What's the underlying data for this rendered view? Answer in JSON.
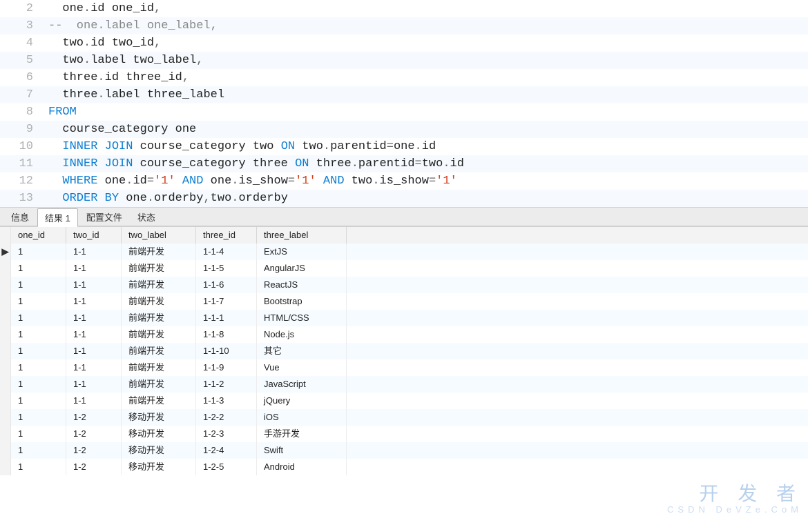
{
  "code": {
    "lines": [
      {
        "num": 2,
        "tokens": [
          {
            "t": "plain",
            "v": "  one"
          },
          {
            "t": "op",
            "v": "."
          },
          {
            "t": "plain",
            "v": "id one_id"
          },
          {
            "t": "op",
            "v": ","
          }
        ]
      },
      {
        "num": 3,
        "tokens": [
          {
            "t": "comment",
            "v": "--  one.label one_label,"
          }
        ]
      },
      {
        "num": 4,
        "tokens": [
          {
            "t": "plain",
            "v": "  two"
          },
          {
            "t": "op",
            "v": "."
          },
          {
            "t": "plain",
            "v": "id two_id"
          },
          {
            "t": "op",
            "v": ","
          }
        ]
      },
      {
        "num": 5,
        "tokens": [
          {
            "t": "plain",
            "v": "  two"
          },
          {
            "t": "op",
            "v": "."
          },
          {
            "t": "plain",
            "v": "label two_label"
          },
          {
            "t": "op",
            "v": ","
          }
        ]
      },
      {
        "num": 6,
        "tokens": [
          {
            "t": "plain",
            "v": "  three"
          },
          {
            "t": "op",
            "v": "."
          },
          {
            "t": "plain",
            "v": "id three_id"
          },
          {
            "t": "op",
            "v": ","
          }
        ]
      },
      {
        "num": 7,
        "tokens": [
          {
            "t": "plain",
            "v": "  three"
          },
          {
            "t": "op",
            "v": "."
          },
          {
            "t": "plain",
            "v": "label three_label"
          }
        ]
      },
      {
        "num": 8,
        "tokens": [
          {
            "t": "keyword",
            "v": "FROM"
          }
        ]
      },
      {
        "num": 9,
        "tokens": [
          {
            "t": "plain",
            "v": "  course_category one"
          }
        ]
      },
      {
        "num": 10,
        "tokens": [
          {
            "t": "plain",
            "v": "  "
          },
          {
            "t": "keyword",
            "v": "INNER JOIN"
          },
          {
            "t": "plain",
            "v": " course_category two "
          },
          {
            "t": "keyword",
            "v": "ON"
          },
          {
            "t": "plain",
            "v": " two"
          },
          {
            "t": "op",
            "v": "."
          },
          {
            "t": "plain",
            "v": "parentid"
          },
          {
            "t": "op",
            "v": "="
          },
          {
            "t": "plain",
            "v": "one"
          },
          {
            "t": "op",
            "v": "."
          },
          {
            "t": "plain",
            "v": "id"
          }
        ]
      },
      {
        "num": 11,
        "tokens": [
          {
            "t": "plain",
            "v": "  "
          },
          {
            "t": "keyword",
            "v": "INNER JOIN"
          },
          {
            "t": "plain",
            "v": " course_category three "
          },
          {
            "t": "keyword",
            "v": "ON"
          },
          {
            "t": "plain",
            "v": " three"
          },
          {
            "t": "op",
            "v": "."
          },
          {
            "t": "plain",
            "v": "parentid"
          },
          {
            "t": "op",
            "v": "="
          },
          {
            "t": "plain",
            "v": "two"
          },
          {
            "t": "op",
            "v": "."
          },
          {
            "t": "plain",
            "v": "id"
          }
        ]
      },
      {
        "num": 12,
        "tokens": [
          {
            "t": "plain",
            "v": "  "
          },
          {
            "t": "keyword",
            "v": "WHERE"
          },
          {
            "t": "plain",
            "v": " one"
          },
          {
            "t": "op",
            "v": "."
          },
          {
            "t": "plain",
            "v": "id"
          },
          {
            "t": "op",
            "v": "="
          },
          {
            "t": "string",
            "v": "'1'"
          },
          {
            "t": "plain",
            "v": " "
          },
          {
            "t": "keyword",
            "v": "AND"
          },
          {
            "t": "plain",
            "v": " one"
          },
          {
            "t": "op",
            "v": "."
          },
          {
            "t": "plain",
            "v": "is_show"
          },
          {
            "t": "op",
            "v": "="
          },
          {
            "t": "string",
            "v": "'1'"
          },
          {
            "t": "plain",
            "v": " "
          },
          {
            "t": "keyword",
            "v": "AND"
          },
          {
            "t": "plain",
            "v": " two"
          },
          {
            "t": "op",
            "v": "."
          },
          {
            "t": "plain",
            "v": "is_show"
          },
          {
            "t": "op",
            "v": "="
          },
          {
            "t": "string",
            "v": "'1'"
          }
        ]
      },
      {
        "num": 13,
        "tokens": [
          {
            "t": "plain",
            "v": "  "
          },
          {
            "t": "keyword",
            "v": "ORDER BY"
          },
          {
            "t": "plain",
            "v": " one"
          },
          {
            "t": "op",
            "v": "."
          },
          {
            "t": "plain",
            "v": "orderby"
          },
          {
            "t": "op",
            "v": ","
          },
          {
            "t": "plain",
            "v": "two"
          },
          {
            "t": "op",
            "v": "."
          },
          {
            "t": "plain",
            "v": "orderby"
          }
        ]
      }
    ]
  },
  "tabs": {
    "items": [
      {
        "label": "信息",
        "active": false
      },
      {
        "label": "结果 1",
        "active": true
      },
      {
        "label": "配置文件",
        "active": false
      },
      {
        "label": "状态",
        "active": false
      }
    ]
  },
  "results": {
    "columns": [
      "one_id",
      "two_id",
      "two_label",
      "three_id",
      "three_label"
    ],
    "rows": [
      {
        "marker": "▶",
        "cells": [
          "1",
          "1-1",
          "前端开发",
          "1-1-4",
          "ExtJS"
        ]
      },
      {
        "marker": "",
        "cells": [
          "1",
          "1-1",
          "前端开发",
          "1-1-5",
          "AngularJS"
        ]
      },
      {
        "marker": "",
        "cells": [
          "1",
          "1-1",
          "前端开发",
          "1-1-6",
          "ReactJS"
        ]
      },
      {
        "marker": "",
        "cells": [
          "1",
          "1-1",
          "前端开发",
          "1-1-7",
          "Bootstrap"
        ]
      },
      {
        "marker": "",
        "cells": [
          "1",
          "1-1",
          "前端开发",
          "1-1-1",
          "HTML/CSS"
        ]
      },
      {
        "marker": "",
        "cells": [
          "1",
          "1-1",
          "前端开发",
          "1-1-8",
          "Node.js"
        ]
      },
      {
        "marker": "",
        "cells": [
          "1",
          "1-1",
          "前端开发",
          "1-1-10",
          "其它"
        ]
      },
      {
        "marker": "",
        "cells": [
          "1",
          "1-1",
          "前端开发",
          "1-1-9",
          "Vue"
        ]
      },
      {
        "marker": "",
        "cells": [
          "1",
          "1-1",
          "前端开发",
          "1-1-2",
          "JavaScript"
        ]
      },
      {
        "marker": "",
        "cells": [
          "1",
          "1-1",
          "前端开发",
          "1-1-3",
          "jQuery"
        ]
      },
      {
        "marker": "",
        "cells": [
          "1",
          "1-2",
          "移动开发",
          "1-2-2",
          "iOS"
        ]
      },
      {
        "marker": "",
        "cells": [
          "1",
          "1-2",
          "移动开发",
          "1-2-3",
          "手游开发"
        ]
      },
      {
        "marker": "",
        "cells": [
          "1",
          "1-2",
          "移动开发",
          "1-2-4",
          "Swift"
        ]
      },
      {
        "marker": "",
        "cells": [
          "1",
          "1-2",
          "移动开发",
          "1-2-5",
          "Android"
        ]
      }
    ]
  },
  "watermark": {
    "main": "开 发 者",
    "sub": "CSDN DeVZe.CoM"
  }
}
